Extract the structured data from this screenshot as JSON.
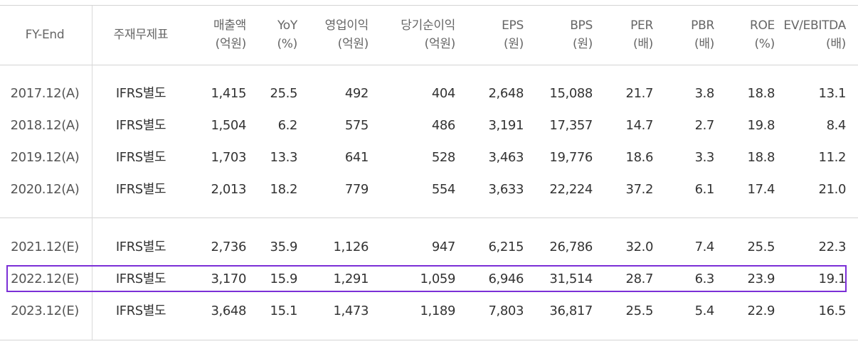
{
  "table": {
    "headers": [
      {
        "line1": "FY-End",
        "line2": ""
      },
      {
        "line1": "주재무제표",
        "line2": ""
      },
      {
        "line1": "매출액",
        "line2": "(억원)"
      },
      {
        "line1": "YoY",
        "line2": "(%)"
      },
      {
        "line1": "영업이익",
        "line2": "(억원)"
      },
      {
        "line1": "당기순이익",
        "line2": "(억원)"
      },
      {
        "line1": "EPS",
        "line2": "(원)"
      },
      {
        "line1": "BPS",
        "line2": "(원)"
      },
      {
        "line1": "PER",
        "line2": "(배)"
      },
      {
        "line1": "PBR",
        "line2": "(배)"
      },
      {
        "line1": "ROE",
        "line2": "(%)"
      },
      {
        "line1": "EV/EBITDA",
        "line2": "(배)"
      }
    ],
    "rows": [
      [
        "2017.12(A)",
        "IFRS별도",
        "1,415",
        "25.5",
        "492",
        "404",
        "2,648",
        "15,088",
        "21.7",
        "3.8",
        "18.8",
        "13.1"
      ],
      [
        "2018.12(A)",
        "IFRS별도",
        "1,504",
        "6.2",
        "575",
        "486",
        "3,191",
        "17,357",
        "14.7",
        "2.7",
        "19.8",
        "8.4"
      ],
      [
        "2019.12(A)",
        "IFRS별도",
        "1,703",
        "13.3",
        "641",
        "528",
        "3,463",
        "19,776",
        "18.6",
        "3.3",
        "18.8",
        "11.2"
      ],
      [
        "2020.12(A)",
        "IFRS별도",
        "2,013",
        "18.2",
        "779",
        "554",
        "3,633",
        "22,224",
        "37.2",
        "6.1",
        "17.4",
        "21.0"
      ],
      [
        "2021.12(E)",
        "IFRS별도",
        "2,736",
        "35.9",
        "1,126",
        "947",
        "6,215",
        "26,786",
        "32.0",
        "7.4",
        "25.5",
        "22.3"
      ],
      [
        "2022.12(E)",
        "IFRS별도",
        "3,170",
        "15.9",
        "1,291",
        "1,059",
        "6,946",
        "31,514",
        "28.7",
        "6.3",
        "23.9",
        "19.1"
      ],
      [
        "2023.12(E)",
        "IFRS별도",
        "3,648",
        "15.1",
        "1,473",
        "1,189",
        "7,803",
        "36,817",
        "25.5",
        "5.4",
        "22.9",
        "16.5"
      ]
    ],
    "highlighted_row": "2022.12(E)",
    "highlight_color": "#7b2fd6"
  }
}
